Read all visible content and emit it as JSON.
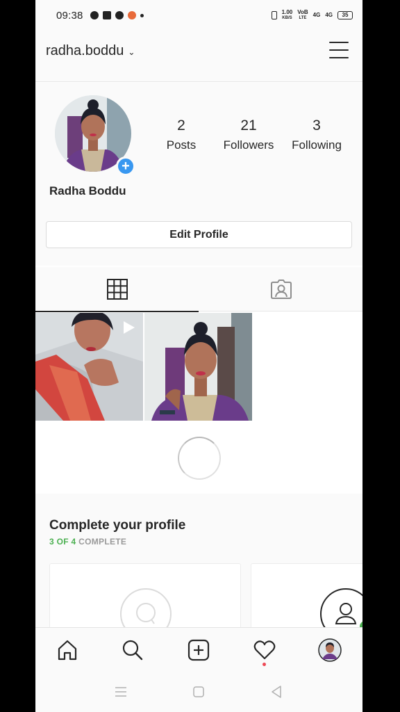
{
  "status_bar": {
    "time": "09:38",
    "net_speed_value": "1.00",
    "net_speed_unit": "KB/S",
    "volte": "VoB",
    "volte_sub": "LTE",
    "sig1": "4G",
    "sig2": "4G",
    "battery": "35"
  },
  "header": {
    "username": "radha.boddu",
    "chevron": "⌄",
    "menu_icon": "hamburger-menu-icon"
  },
  "profile": {
    "full_name": "Radha Boddu",
    "add_badge": "+",
    "stats": [
      {
        "value": "2",
        "label": "Posts"
      },
      {
        "value": "21",
        "label": "Followers"
      },
      {
        "value": "3",
        "label": "Following"
      }
    ],
    "edit_button": "Edit Profile"
  },
  "tabs": [
    {
      "icon": "grid-icon",
      "active": true
    },
    {
      "icon": "tagged-person-icon",
      "active": false
    }
  ],
  "posts": [
    {
      "type": "video",
      "icon": "play-icon"
    },
    {
      "type": "photo"
    }
  ],
  "complete_profile": {
    "title": "Complete your profile",
    "progress_done": "3 OF 4",
    "progress_rest": " COMPLETE"
  },
  "bottom_nav": [
    {
      "name": "home",
      "icon": "home-icon"
    },
    {
      "name": "search",
      "icon": "search-icon"
    },
    {
      "name": "new-post",
      "icon": "plus-square-icon"
    },
    {
      "name": "activity",
      "icon": "heart-icon"
    },
    {
      "name": "profile",
      "icon": "avatar-icon"
    }
  ],
  "colors": {
    "accent_blue": "#3897f0",
    "complete_green": "#4cb051",
    "notification_red": "#ed4956",
    "text": "#262626"
  }
}
